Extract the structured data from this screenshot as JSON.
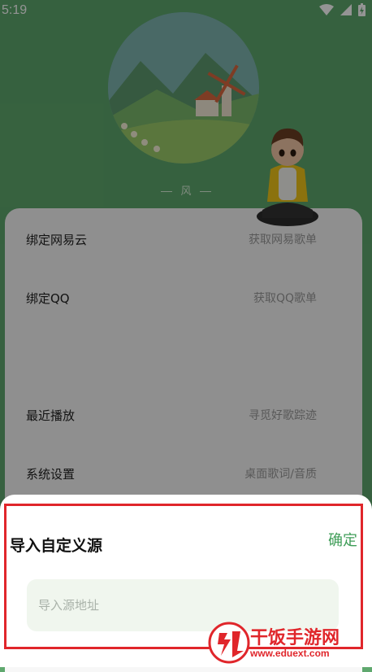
{
  "status_bar": {
    "time": "5:19"
  },
  "header": {
    "caption": "风"
  },
  "menu": [
    {
      "label": "绑定网易云",
      "hint": "获取网易歌单"
    },
    {
      "label": "绑定QQ",
      "hint": "获取QQ歌单"
    },
    {
      "label": "最近播放",
      "hint": "寻觅好歌踪迹"
    },
    {
      "label": "系统设置",
      "hint": "桌面歌词/音质"
    }
  ],
  "sheet": {
    "title": "导入自定义源",
    "confirm_label": "确定",
    "input_placeholder": "导入源地址",
    "input_value": ""
  },
  "watermark": {
    "brand": "干饭手游网",
    "url": "www.eduext.com"
  },
  "colors": {
    "header_green": "#5ea86d",
    "confirm_green": "#3f9d58",
    "highlight_red": "#e0262b"
  }
}
